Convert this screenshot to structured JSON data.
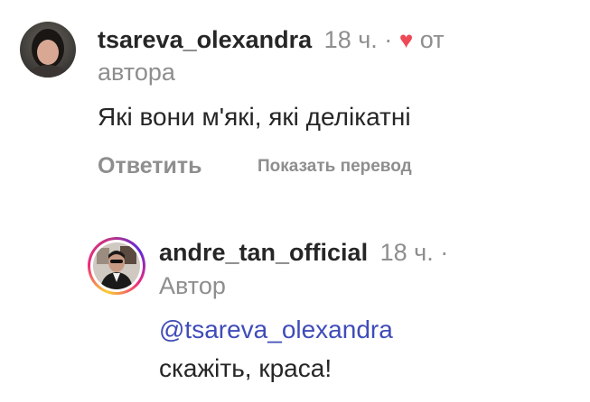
{
  "comment1": {
    "username": "tsareva_olexandra",
    "time": "18 ч.",
    "separator": "·",
    "heart_icon": "heart-icon",
    "liked_by_prefix": "от",
    "liked_by_suffix": "автора",
    "text": "Які вони м'які, які делікатні",
    "reply_label": "Ответить",
    "translate_label": "Показать перевод"
  },
  "reply1": {
    "username": "andre_tan_official",
    "time": "18 ч.",
    "separator": "·",
    "author_badge": "Автор",
    "mention": "@tsareva_olexandra",
    "text": "скажіть, краса!"
  },
  "colors": {
    "text": "#262626",
    "secondary": "#8e8e8e",
    "heart": "#ed4956",
    "mention": "#3f4cb8",
    "story_ring_start": "#f9ce34",
    "story_ring_end": "#c13584"
  }
}
